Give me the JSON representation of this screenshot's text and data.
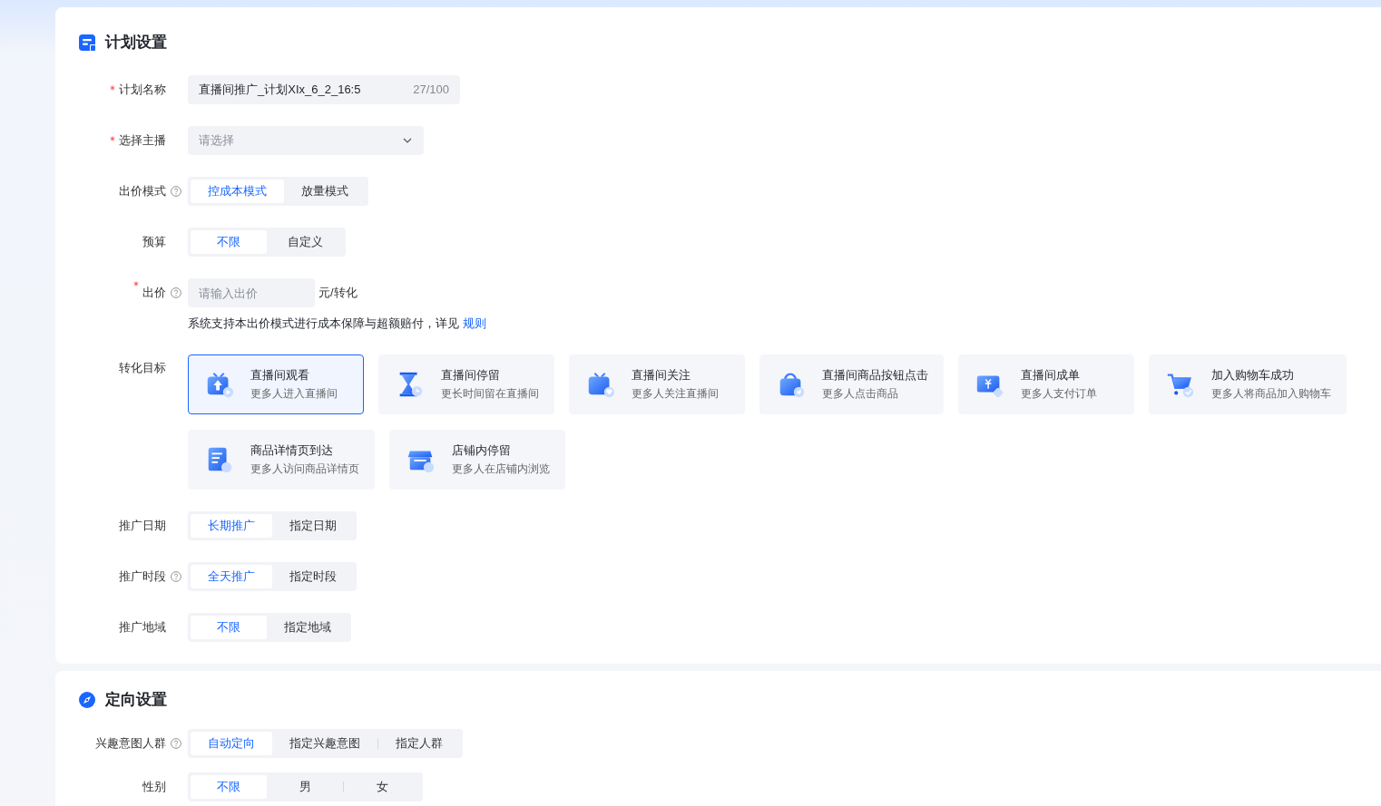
{
  "sections": [
    {
      "title": "计划设置",
      "rows": [
        {
          "kind": "text_input",
          "label": "计划名称",
          "required": true,
          "help": false,
          "value": "直播间推广_计划XIx_6_2_16:5",
          "counter": "27/100"
        },
        {
          "kind": "select",
          "label": "选择主播",
          "required": true,
          "help": false,
          "placeholder": "请选择"
        },
        {
          "kind": "segmented",
          "label": "出价模式",
          "required": false,
          "help": true,
          "options": [
            {
              "label": "控成本模式",
              "selected": true
            },
            {
              "label": "放量模式",
              "selected": false
            }
          ]
        },
        {
          "kind": "segmented",
          "label": "预算",
          "required": false,
          "help": false,
          "options": [
            {
              "label": "不限",
              "selected": true
            },
            {
              "label": "自定义",
              "selected": false
            }
          ]
        },
        {
          "kind": "price_input",
          "label": "出价",
          "required": true,
          "help": true,
          "placeholder": "请输入出价",
          "unit": "元/转化",
          "note": "系统支持本出价模式进行成本保障与超额赔付，详见",
          "link": "规则"
        },
        {
          "kind": "targets",
          "label": "转化目标",
          "required": false,
          "help": false,
          "targets": [
            {
              "title": "直播间观看",
              "desc": "更多人进入直播间",
              "selected": true
            },
            {
              "title": "直播间停留",
              "desc": "更长时间留在直播间",
              "selected": false
            },
            {
              "title": "直播间关注",
              "desc": "更多人关注直播间",
              "selected": false
            },
            {
              "title": "直播间商品按钮点击",
              "desc": "更多人点击商品",
              "selected": false
            },
            {
              "title": "直播间成单",
              "desc": "更多人支付订单",
              "selected": false
            },
            {
              "title": "加入购物车成功",
              "desc": "更多人将商品加入购物车",
              "selected": false
            },
            {
              "title": "商品详情页到达",
              "desc": "更多人访问商品详情页",
              "selected": false
            },
            {
              "title": "店铺内停留",
              "desc": "更多人在店铺内浏览",
              "selected": false
            }
          ]
        },
        {
          "kind": "segmented",
          "label": "推广日期",
          "required": false,
          "help": false,
          "options": [
            {
              "label": "长期推广",
              "selected": true
            },
            {
              "label": "指定日期",
              "selected": false
            }
          ]
        },
        {
          "kind": "segmented",
          "label": "推广时段",
          "required": false,
          "help": true,
          "options": [
            {
              "label": "全天推广",
              "selected": true
            },
            {
              "label": "指定时段",
              "selected": false
            }
          ]
        },
        {
          "kind": "segmented",
          "label": "推广地域",
          "required": false,
          "help": false,
          "options": [
            {
              "label": "不限",
              "selected": true
            },
            {
              "label": "指定地域",
              "selected": false
            }
          ]
        }
      ]
    },
    {
      "title": "定向设置",
      "rows": [
        {
          "kind": "segmented",
          "label": "兴趣意图人群",
          "required": false,
          "help": true,
          "options": [
            {
              "label": "自动定向",
              "selected": true
            },
            {
              "label": "指定兴趣意图",
              "selected": false
            },
            {
              "label": "指定人群",
              "selected": false
            }
          ]
        },
        {
          "kind": "segmented",
          "label": "性别",
          "required": false,
          "help": false,
          "options": [
            {
              "label": "不限",
              "selected": true
            },
            {
              "label": "男",
              "selected": false
            },
            {
              "label": "女",
              "selected": false
            }
          ]
        }
      ]
    }
  ]
}
